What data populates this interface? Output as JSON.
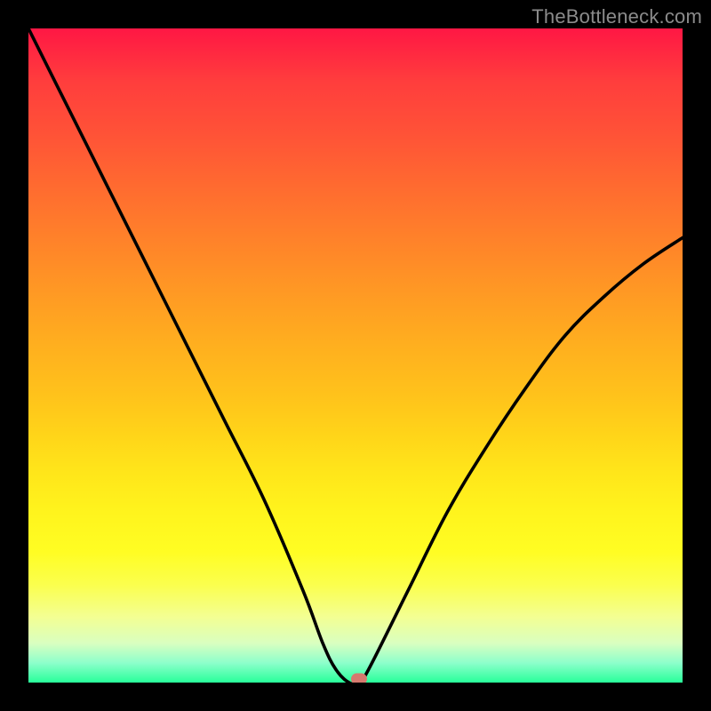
{
  "watermark": "TheBottleneck.com",
  "chart_data": {
    "type": "line",
    "title": "",
    "xlabel": "",
    "ylabel": "",
    "xlim": [
      0,
      100
    ],
    "ylim": [
      0,
      100
    ],
    "grid": false,
    "series": [
      {
        "name": "curve",
        "x": [
          0,
          6,
          12,
          18,
          24,
          30,
          36,
          42,
          45,
          47,
          49,
          50.5,
          52,
          58,
          64,
          70,
          76,
          82,
          88,
          94,
          100
        ],
        "values": [
          100,
          88,
          76,
          64,
          52,
          40,
          28,
          14,
          6,
          2,
          0,
          0,
          2,
          14,
          26,
          36,
          45,
          53,
          59,
          64,
          68
        ]
      }
    ],
    "marker": {
      "x": 50.5,
      "y": 0.6
    },
    "colors": {
      "curve": "#000000",
      "marker": "#d6796e",
      "gradient_stops": [
        "#ff1744",
        "#ffe61a",
        "#28ff9a"
      ]
    }
  }
}
